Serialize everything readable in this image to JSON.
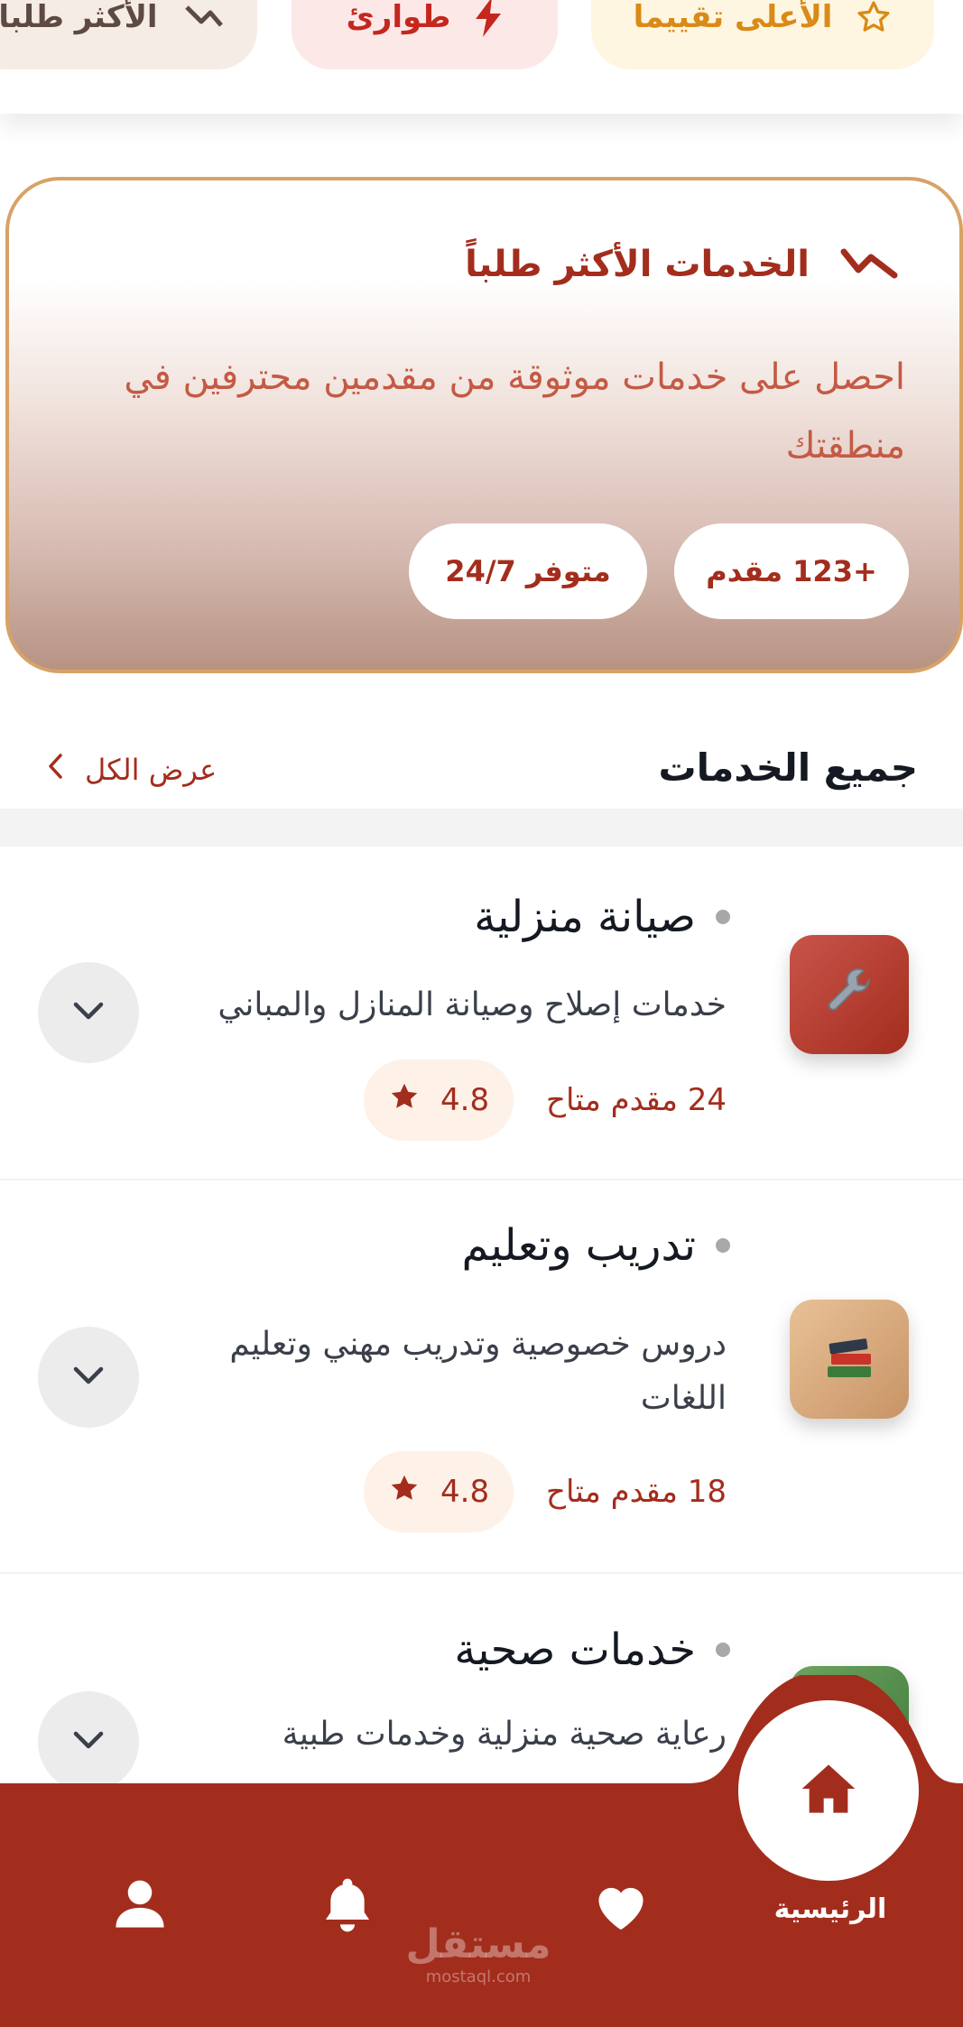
{
  "filters": {
    "top_rated": "الأعلى تقييما",
    "emergency": "طوارئ",
    "most_requested": "الأكثر طلبا"
  },
  "hero": {
    "title": "الخدمات الأكثر طلباً",
    "description": "احصل على خدمات موثوقة من مقدمين محترفين في منطقتك",
    "providers_pill": "+123 مقدم",
    "availability_pill": "متوفر 24/7"
  },
  "section": {
    "title": "جميع الخدمات",
    "view_all": "عرض الكل"
  },
  "services": [
    {
      "title": "صيانة منزلية",
      "description": "خدمات إصلاح وصيانة المنازل والمباني",
      "providers": "24 مقدم متاح",
      "rating": "4.8",
      "icon": "wrench-icon",
      "color": "#b13a2c"
    },
    {
      "title": "تدريب وتعليم",
      "description": "دروس خصوصية وتدريب مهني وتعليم اللغات",
      "providers": "18 مقدم متاح",
      "rating": "4.8",
      "icon": "books-icon",
      "color": "#d7a677"
    },
    {
      "title": "خدمات صحية",
      "description": "رعاية صحية منزلية وخدمات طبية",
      "icon": "health-icon",
      "color": "#4d8a4a"
    }
  ],
  "nav": {
    "home": "الرئيسية",
    "items": [
      "profile-icon",
      "bell-icon",
      "heart-icon",
      "home-icon"
    ]
  },
  "watermark": {
    "brand": "مستقل",
    "domain": "mostaql.com"
  },
  "colors": {
    "primary": "#a32d1d",
    "accent_border": "#d8a266",
    "star_outline": "#d98a17"
  }
}
